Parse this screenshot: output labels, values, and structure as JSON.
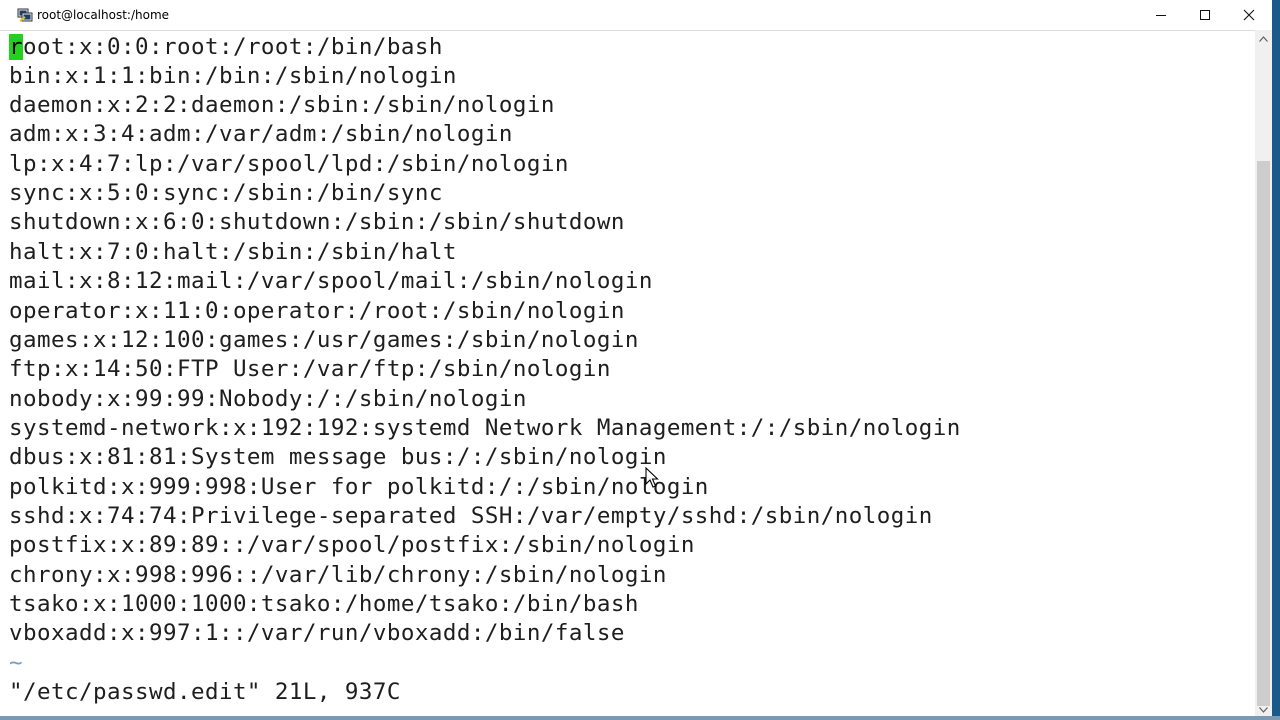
{
  "window": {
    "title": "root@localhost:/home",
    "icon": "putty-terminal-icon",
    "controls": [
      "minimize-icon",
      "maximize-icon",
      "close-icon"
    ]
  },
  "terminal": {
    "cursor_char": "r",
    "first_line_rest": "oot:x:0:0:root:/root:/bin/bash",
    "lines": [
      "bin:x:1:1:bin:/bin:/sbin/nologin",
      "daemon:x:2:2:daemon:/sbin:/sbin/nologin",
      "adm:x:3:4:adm:/var/adm:/sbin/nologin",
      "lp:x:4:7:lp:/var/spool/lpd:/sbin/nologin",
      "sync:x:5:0:sync:/sbin:/bin/sync",
      "shutdown:x:6:0:shutdown:/sbin:/sbin/shutdown",
      "halt:x:7:0:halt:/sbin:/sbin/halt",
      "mail:x:8:12:mail:/var/spool/mail:/sbin/nologin",
      "operator:x:11:0:operator:/root:/sbin/nologin",
      "games:x:12:100:games:/usr/games:/sbin/nologin",
      "ftp:x:14:50:FTP User:/var/ftp:/sbin/nologin",
      "nobody:x:99:99:Nobody:/:/sbin/nologin",
      "systemd-network:x:192:192:systemd Network Management:/:/sbin/nologin",
      "dbus:x:81:81:System message bus:/:/sbin/nologin",
      "polkitd:x:999:998:User for polkitd:/:/sbin/nologin",
      "sshd:x:74:74:Privilege-separated SSH:/var/empty/sshd:/sbin/nologin",
      "postfix:x:89:89::/var/spool/postfix:/sbin/nologin",
      "chrony:x:998:996::/var/lib/chrony:/sbin/nologin",
      "tsako:x:1000:1000:tsako:/home/tsako:/bin/bash",
      "vboxadd:x:997:1::/var/run/vboxadd:/bin/false"
    ],
    "empty_line_marker": "~",
    "status_line": "\"/etc/passwd.edit\" 21L, 937C"
  },
  "colors": {
    "cursor": "#21d21b",
    "tilde": "#6ea0c8",
    "text": "#1e1e1e"
  }
}
